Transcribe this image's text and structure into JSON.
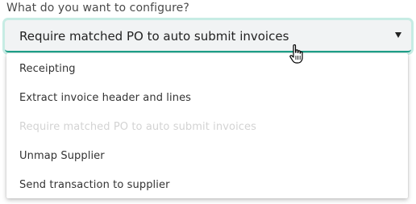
{
  "question": "What do you want to configure?",
  "select": {
    "value": "Require matched PO to auto submit invoices"
  },
  "menu": {
    "items": [
      {
        "label": "Receipting",
        "disabled": false
      },
      {
        "label": "Extract invoice header and lines",
        "disabled": false
      },
      {
        "label": "Require matched PO to auto submit invoices",
        "disabled": true
      },
      {
        "label": "Unmap Supplier",
        "disabled": false
      },
      {
        "label": "Send transaction to supplier",
        "disabled": false
      }
    ]
  },
  "colors": {
    "focus_ring": "#c7ece4",
    "accent_underline": "#1fa08a",
    "disabled_text": "#d3d3d3"
  },
  "icons": {
    "dropdown_arrow": "caret-down-icon",
    "cursor": "hand-pointer-icon"
  }
}
